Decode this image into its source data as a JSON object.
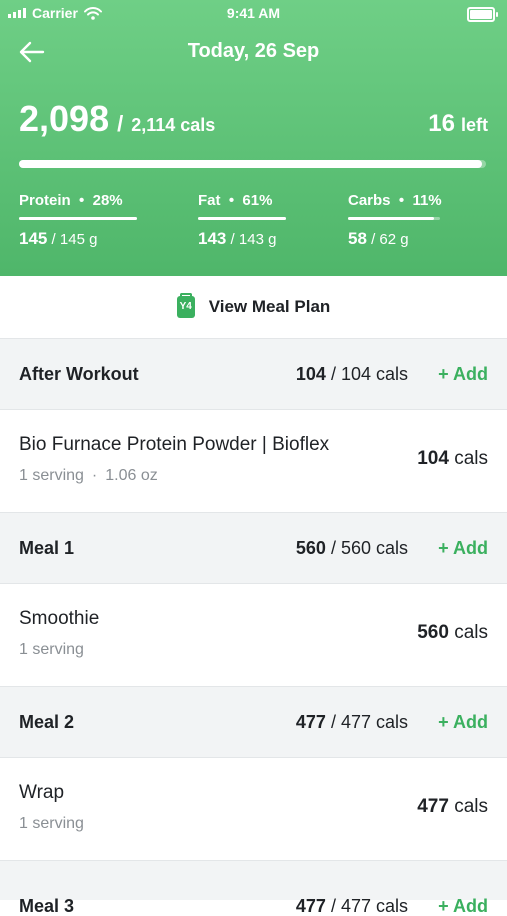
{
  "status_bar": {
    "carrier": "Carrier",
    "time": "9:41 AM"
  },
  "header": {
    "title": "Today, 26 Sep",
    "calories_consumed": "2,098",
    "calories_slash": "/",
    "calories_goal": "2,114 cals",
    "calories_left_value": "16",
    "calories_left_label": "left",
    "progress_fraction": 0.992
  },
  "macros": [
    {
      "label": "Protein",
      "percent": "28%",
      "current": "145",
      "target": "/ 145 g",
      "fraction": 1.0
    },
    {
      "label": "Fat",
      "percent": "61%",
      "current": "143",
      "target": "/ 143 g",
      "fraction": 1.0
    },
    {
      "label": "Carbs",
      "percent": "11%",
      "current": "58",
      "target": "/ 62 g",
      "fraction": 0.935
    }
  ],
  "meal_plan_button": {
    "label": "View Meal Plan",
    "icon_text": "Y4"
  },
  "sections": [
    {
      "name": "After Workout",
      "cals_current": "104",
      "cals_goal": "/ 104 cals",
      "add_label": "+ Add",
      "item": {
        "title": "Bio Furnace Protein Powder | Bioflex",
        "serving": "1 serving",
        "dot": "·",
        "weight": "1.06 oz",
        "kcal_value": "104",
        "kcal_unit": "cals"
      }
    },
    {
      "name": "Meal 1",
      "cals_current": "560",
      "cals_goal": "/ 560 cals",
      "add_label": "+ Add",
      "item": {
        "title": "Smoothie",
        "serving": "1 serving",
        "dot": "",
        "weight": "",
        "kcal_value": "560",
        "kcal_unit": "cals"
      }
    },
    {
      "name": "Meal 2",
      "cals_current": "477",
      "cals_goal": "/ 477 cals",
      "add_label": "+ Add",
      "item": {
        "title": "Wrap",
        "serving": "1 serving",
        "dot": "",
        "weight": "",
        "kcal_value": "477",
        "kcal_unit": "cals"
      }
    },
    {
      "name": "Meal 3",
      "cals_current": "477",
      "cals_goal": "/ 477 cals",
      "add_label": "+ Add"
    }
  ],
  "colors": {
    "header_top": "#6fcf86",
    "header_bottom": "#4fb66a",
    "accent": "#3bb05f",
    "section_bg": "#f2f4f5"
  }
}
